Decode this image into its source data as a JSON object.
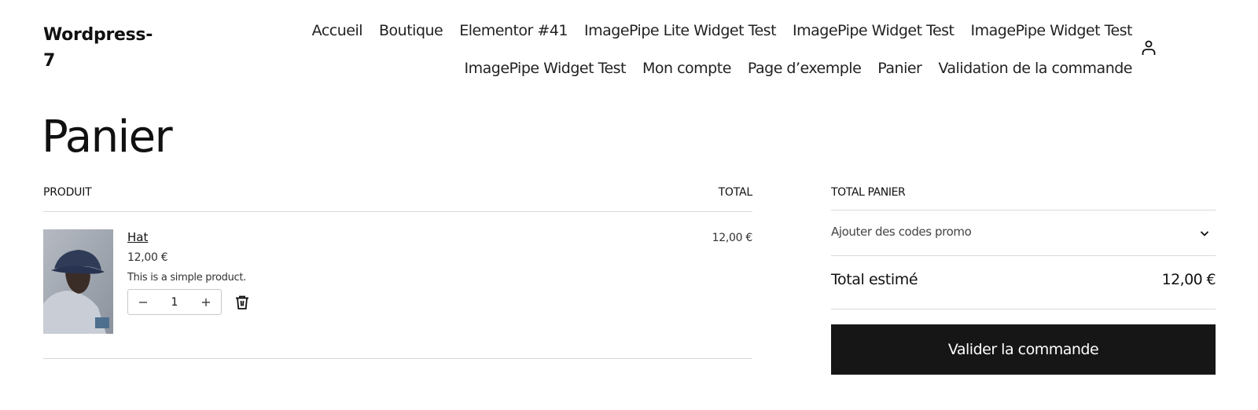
{
  "site": {
    "title_line1": "Wordpress-",
    "title_line2": "7"
  },
  "nav": {
    "items": [
      "Accueil",
      "Boutique",
      "Elementor #41",
      "ImagePipe Lite Widget Test",
      "ImagePipe Widget Test",
      "ImagePipe Widget Test",
      "ImagePipe Widget Test",
      "Mon compte",
      "Page d’exemple",
      "Panier",
      "Validation de la commande"
    ],
    "account_icon": "account-icon"
  },
  "page": {
    "title": "Panier"
  },
  "cart_table": {
    "headers": {
      "product": "PRODUIT",
      "total": "TOTAL"
    },
    "items": [
      {
        "name": "Hat",
        "price": "12,00 €",
        "description": "This is a simple product.",
        "quantity": "1",
        "row_total": "12,00 €",
        "image_icon": "product-image",
        "remove_icon": "trash-icon"
      }
    ]
  },
  "totals": {
    "title": "TOTAL PANIER",
    "coupon_label": "Ajouter des codes promo",
    "estimated_label": "Total estimé",
    "estimated_value": "12,00 €",
    "checkout_label": "Valider la commande"
  },
  "colors": {
    "button_bg": "#161616",
    "button_text": "#ffffff",
    "divider": "#d9d9d9"
  }
}
